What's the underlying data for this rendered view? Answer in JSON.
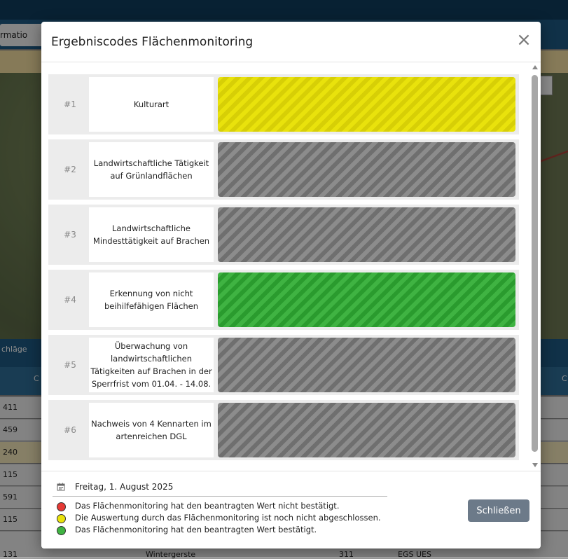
{
  "background": {
    "tab_fragment": "rmatio",
    "table_fragment_left": "chläge",
    "table_fragment_col": "C",
    "table_fragment_right": "C",
    "rows": [
      "411",
      "459",
      "240",
      "115",
      "591",
      "115",
      "131"
    ],
    "bottom_cells": [
      "Wintergerste",
      "311",
      "EGS UES"
    ]
  },
  "modal": {
    "title": "Ergebniscodes Flächenmonitoring",
    "close_symbol": "×",
    "rows": [
      {
        "num": "#1",
        "label": "Kulturart",
        "status": "yellow"
      },
      {
        "num": "#2",
        "label": "Landwirtschaftliche Tätigkeit auf Grünlandflächen",
        "status": "grey"
      },
      {
        "num": "#3",
        "label": "Landwirtschaftliche Mindesttätigkeit auf Brachen",
        "status": "grey"
      },
      {
        "num": "#4",
        "label": "Erkennung von nicht beihilfefähigen Flächen",
        "status": "green"
      },
      {
        "num": "#5",
        "label": "Überwachung von landwirtschaftlichen Tätigkeiten auf Brachen in der Sperrfrist vom 01.04. - 14.08.",
        "status": "grey"
      },
      {
        "num": "#6",
        "label": "Nachweis von 4 Kennarten im artenreichen DGL",
        "status": "grey"
      }
    ],
    "footer": {
      "date": "Freitag, 1. August 2025",
      "date_icon": "calendar-icon",
      "legend": [
        {
          "color": "#e53935",
          "text": "Das Flächenmonitoring hat den beantragten Wert nicht bestätigt."
        },
        {
          "color": "#e9e20c",
          "text": "Die Auswertung durch das Flächenmonitoring ist noch nicht abgeschlossen."
        },
        {
          "color": "#3fb342",
          "text": "Das Flächenmonitoring hat den beantragten Wert bestätigt."
        }
      ],
      "close_label": "Schließen"
    }
  },
  "colors": {
    "yellow": "#e9e20c",
    "grey": "#8c8c8c",
    "green": "#3fb342",
    "button": "#6c7a89"
  }
}
